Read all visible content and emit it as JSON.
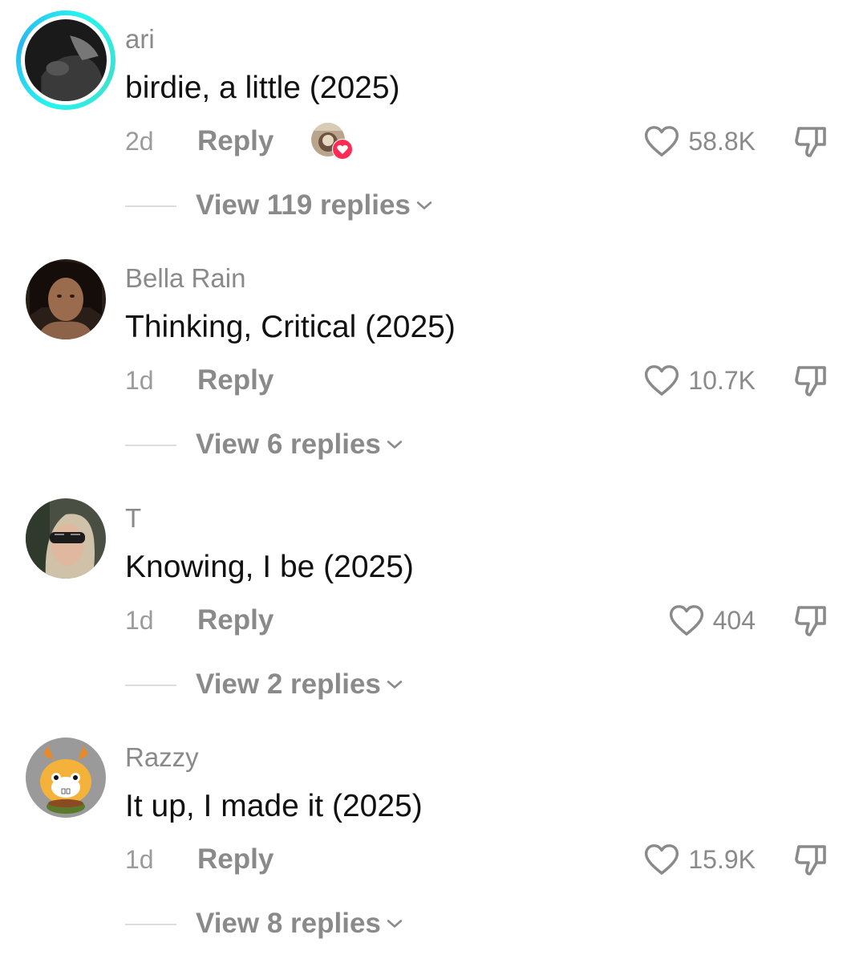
{
  "comments": [
    {
      "username": "ari",
      "text": "birdie, a little (2025)",
      "time": "2d",
      "reply_label": "Reply",
      "likes": "58.8K",
      "replies_label": "View 119 replies",
      "creator_liked": true,
      "story_ring": true
    },
    {
      "username": "Bella Rain",
      "text": "Thinking, Critical (2025)",
      "time": "1d",
      "reply_label": "Reply",
      "likes": "10.7K",
      "replies_label": "View 6 replies",
      "creator_liked": false,
      "story_ring": false
    },
    {
      "username": "T",
      "text": "Knowing, I be (2025)",
      "time": "1d",
      "reply_label": "Reply",
      "likes": "404",
      "replies_label": "View 2 replies",
      "creator_liked": false,
      "story_ring": false
    },
    {
      "username": "Razzy",
      "text": "It up, I made it (2025)",
      "time": "1d",
      "reply_label": "Reply",
      "likes": "15.9K",
      "replies_label": "View 8 replies",
      "creator_liked": false,
      "story_ring": false
    }
  ],
  "colors": {
    "story_ring": "#25f4ee",
    "heart_badge": "#fe2c55",
    "muted_text": "#8a8a8a",
    "primary_text": "#111111"
  },
  "icons": {
    "like": "heart-outline-icon",
    "dislike": "thumbs-down-icon",
    "expand": "chevron-down-icon",
    "creator_like": "heart-badge-icon"
  }
}
